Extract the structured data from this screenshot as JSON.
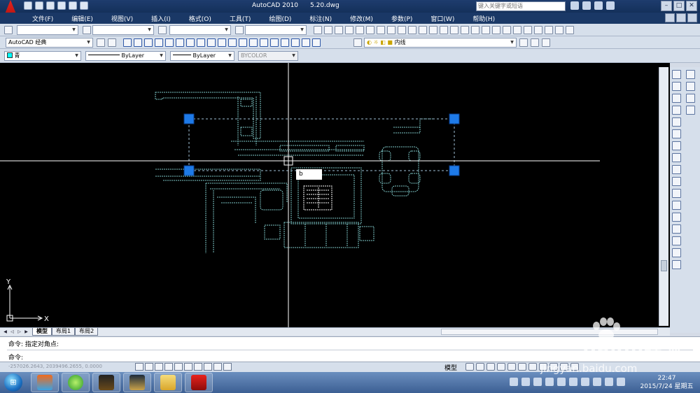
{
  "window": {
    "title": "AutoCAD 2010",
    "file": "5.20.dwg",
    "search_placeholder": "键入关键字或短语",
    "controls": [
      "–",
      "□",
      "✕"
    ]
  },
  "menu": {
    "items": [
      "文件(F)",
      "编辑(E)",
      "视图(V)",
      "插入(I)",
      "格式(O)",
      "工具(T)",
      "绘图(D)",
      "标注(N)",
      "修改(M)",
      "参数(P)",
      "窗口(W)",
      "帮助(H)"
    ]
  },
  "toolbar": {
    "workspace": "AutoCAD 经典",
    "layer": "内线",
    "color": "青",
    "linetype": "ByLayer",
    "lineweight": "ByLayer",
    "plotstyle": "BYCOLOR"
  },
  "canvas": {
    "input_value": "b",
    "ucs_y": "Y",
    "ucs_x": "X",
    "background": "#000000",
    "line_color": "#7ec8c8",
    "grip_color": "#1e7ae8"
  },
  "tabs": {
    "items": [
      "模型",
      "布局1",
      "布局2"
    ],
    "active": "模型"
  },
  "command": {
    "line1": "命令: 指定对角点:",
    "line2": "命令:"
  },
  "status": {
    "coords": "-257026.2643,  2039496.2655,  0.0000",
    "model": "模型"
  },
  "taskbar": {
    "time": "22:47",
    "date": "2015/7/24 星期五"
  },
  "watermark": {
    "brand": "Baidu经验",
    "url": "jingyan.baidu.com"
  }
}
